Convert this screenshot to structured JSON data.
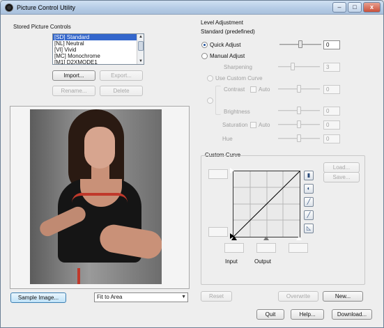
{
  "window": {
    "title": "Picture Control Utility",
    "minimize": "–",
    "maximize": "□",
    "close": "x"
  },
  "stored": {
    "heading": "Stored Picture Controls",
    "items": [
      "[SD] Standard",
      "[NL] Neutral",
      "[VI] Vivid",
      "[MC] Monochrome",
      "[M1] D2XMODE1"
    ],
    "buttons": {
      "import": "Import...",
      "export": "Export...",
      "rename": "Rename...",
      "delete": "Delete"
    }
  },
  "preview": {
    "sample_button": "Sample Image...",
    "fit_value": "Fit to Area",
    "fit_arrow": "▼"
  },
  "level": {
    "heading": "Level Adjustment",
    "subtitle": "Standard (predefined)",
    "quick_adjust": {
      "label": "Quick Adjust",
      "value": "0",
      "fraction": 0.5
    },
    "manual_adjust": {
      "label": "Manual Adjust"
    },
    "sharpening": {
      "label": "Sharpening",
      "value": "3",
      "fraction": 0.33
    },
    "use_custom_curve": "Use Custom Curve",
    "contrast": {
      "label": "Contrast",
      "auto": "Auto",
      "value": "0",
      "fraction": 0.5
    },
    "brightness": {
      "label": "Brightness",
      "value": "0",
      "fraction": 0.5
    },
    "saturation": {
      "label": "Saturation",
      "auto": "Auto",
      "value": "0",
      "fraction": 0.5
    },
    "hue": {
      "label": "Hue",
      "value": "0",
      "fraction": 0.5
    }
  },
  "curve": {
    "heading": "Custom Curve",
    "load": "Load...",
    "save": "Save...",
    "input_label": "Input",
    "output_label": "Output",
    "tools": [
      "histogram-icon",
      "contrast-icon",
      "eyedropper-black-icon",
      "eyedropper-gray-icon",
      "eyedropper-white-icon",
      "reset-curve-icon"
    ]
  },
  "footer": {
    "reset": "Reset",
    "overwrite": "Overwrite",
    "new": "New...",
    "quit": "Quit",
    "help": "Help...",
    "download": "Download..."
  },
  "colors": {
    "accent": "#3366cc",
    "lace": "#c0392b"
  }
}
